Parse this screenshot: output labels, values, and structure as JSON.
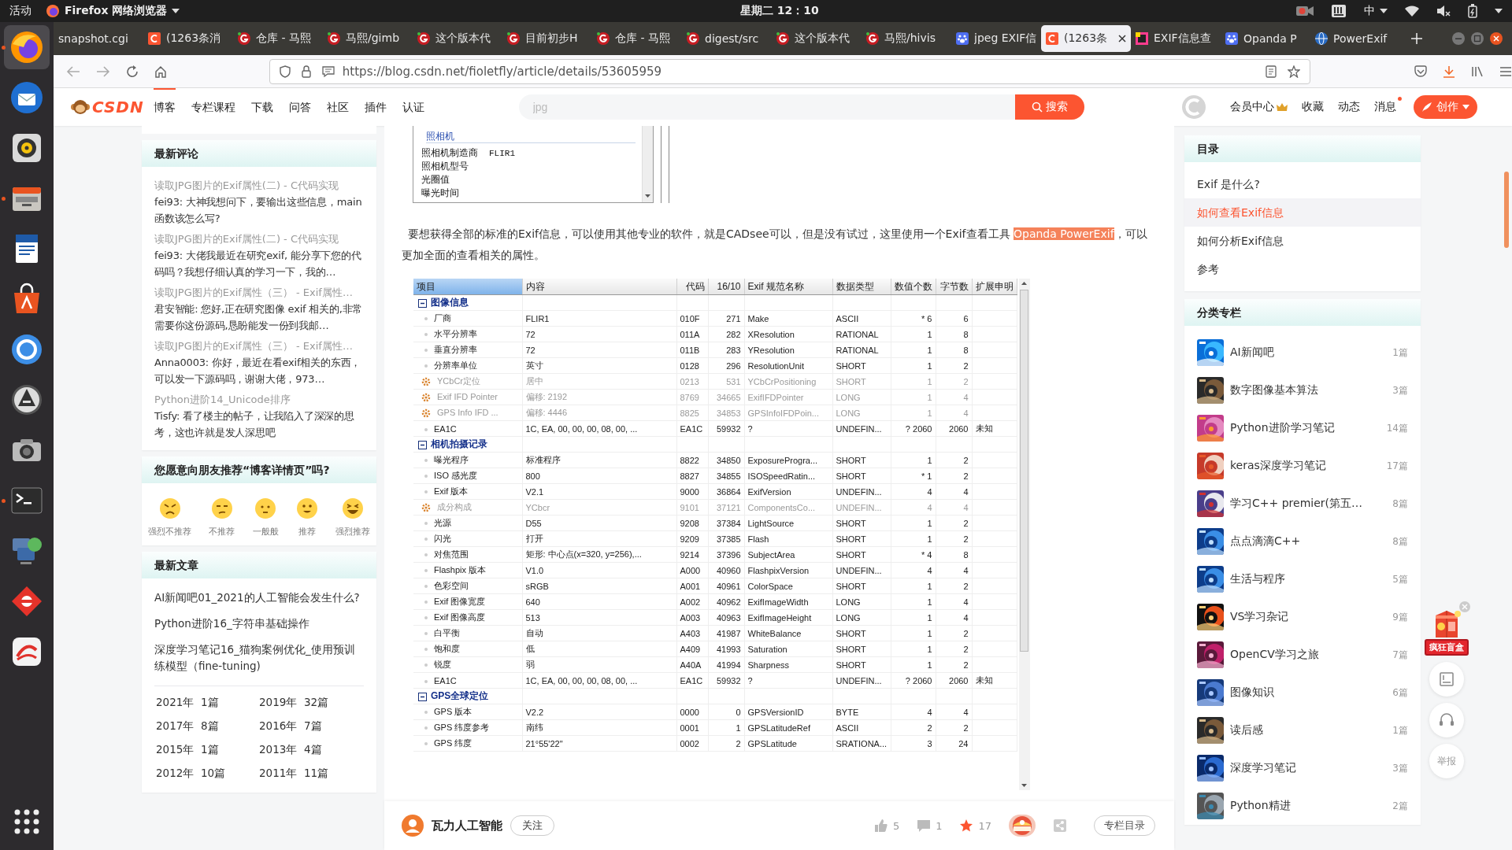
{
  "system_bar": {
    "activities": "活动",
    "app_menu": "Firefox 网络浏览器",
    "clock": "星期二 12：10",
    "input_method": "中"
  },
  "dock": [
    {
      "kind": "browser",
      "running": true,
      "selected": true
    },
    {
      "kind": "mail",
      "running": false,
      "selected": false
    },
    {
      "kind": "music",
      "running": false,
      "selected": false
    },
    {
      "kind": "files",
      "running": true,
      "selected": false
    },
    {
      "kind": "writer",
      "running": false,
      "selected": false
    },
    {
      "kind": "software",
      "running": false,
      "selected": false
    },
    {
      "kind": "help",
      "running": false,
      "selected": false
    },
    {
      "kind": "updater",
      "running": false,
      "selected": false
    },
    {
      "kind": "camera",
      "running": false,
      "selected": false
    },
    {
      "kind": "terminal",
      "running": true,
      "selected": false
    },
    {
      "kind": "network",
      "running": false,
      "selected": false
    },
    {
      "kind": "diamond",
      "running": false,
      "selected": false
    },
    {
      "kind": "swirl",
      "running": false,
      "selected": false
    },
    {
      "kind": "grid",
      "running": false,
      "selected": false
    }
  ],
  "tabs": [
    {
      "title": "snapshot.cgi",
      "kind": "plain",
      "selected": false
    },
    {
      "title": "(1263条消",
      "kind": "csdn",
      "selected": false
    },
    {
      "title": "仓库 - 马熙",
      "kind": "gitee",
      "selected": false
    },
    {
      "title": "马熙/gimb",
      "kind": "gitee",
      "selected": false
    },
    {
      "title": "这个版本代",
      "kind": "gitee",
      "selected": false
    },
    {
      "title": "目前初步H",
      "kind": "gitee",
      "selected": false
    },
    {
      "title": "仓库 - 马熙",
      "kind": "gitee",
      "selected": false
    },
    {
      "title": "digest/src",
      "kind": "gitee",
      "selected": false
    },
    {
      "title": "这个版本代",
      "kind": "gitee",
      "selected": false
    },
    {
      "title": "马熙/hivis",
      "kind": "gitee",
      "selected": false
    },
    {
      "title": "jpeg EXIF信",
      "kind": "paw",
      "selected": false
    },
    {
      "title": "(1263条",
      "kind": "csdn",
      "selected": true
    },
    {
      "title": "EXIF信息查",
      "kind": "exif",
      "selected": false
    },
    {
      "title": "Opanda P",
      "kind": "paw",
      "selected": false
    },
    {
      "title": "PowerExif",
      "kind": "globe",
      "selected": false
    }
  ],
  "address_bar": {
    "url": "https://blog.csdn.net/fioletfly/article/details/53605959"
  },
  "site_header": {
    "logo": "CSDN",
    "nav": [
      {
        "label": "博客",
        "selected": true
      },
      {
        "label": "专栏课程",
        "selected": false
      },
      {
        "label": "下载",
        "selected": false
      },
      {
        "label": "问答",
        "selected": false
      },
      {
        "label": "社区",
        "selected": false
      },
      {
        "label": "插件",
        "selected": false
      },
      {
        "label": "认证",
        "selected": false
      }
    ],
    "search": {
      "placeholder": "jpg",
      "button": "搜索"
    },
    "links": [
      {
        "label": "会员中心",
        "crown": true,
        "unread": false
      },
      {
        "label": "收藏",
        "crown": false,
        "unread": false
      },
      {
        "label": "动态",
        "crown": false,
        "unread": false
      },
      {
        "label": "消息",
        "crown": false,
        "unread": true
      }
    ],
    "create_button": "创作"
  },
  "left_sidebar": {
    "comments": {
      "title": "最新评论",
      "items": [
        {
          "article": "读取JPG图片的Exif属性(二) - C代码实现",
          "comment": "fei93: 大神我想问下，要输出这些信息，main函数该怎么写?"
        },
        {
          "article": "读取JPG图片的Exif属性(二) - C代码实现",
          "comment": "fei93: 大佬我最近在研究exif, 能分享下您的代码吗？我想仔细认真的学习一下，我的…"
        },
        {
          "article": "读取JPG图片的Exif属性（三） - Exif属性…",
          "comment": "君安智能: 您好,正在研究图像 exif 相关的,非常需要你这份源码,恳盼能发一份到我邮…"
        },
        {
          "article": "读取JPG图片的Exif属性（三） - Exif属性…",
          "comment": "Anna0003: 你好，最近在看exif相关的东西，可以发一下源码吗，谢谢大佬，973…"
        },
        {
          "article": "Python进阶14_Unicode排序",
          "comment": "Tisfy: 看了楼主的帖子，让我陷入了深深的思考，这也许就是发人深思吧"
        }
      ]
    },
    "recommend": {
      "title": "您愿意向朋友推荐“博客详情页”吗?",
      "options": [
        {
          "label": "强烈不推荐",
          "kind": "angry"
        },
        {
          "label": "不推荐",
          "kind": "sad"
        },
        {
          "label": "一般般",
          "kind": "neutral"
        },
        {
          "label": "推荐",
          "kind": "smile"
        },
        {
          "label": "强烈推荐",
          "kind": "laugh"
        }
      ]
    },
    "articles": {
      "title": "最新文章",
      "items": [
        "AI新闻吧01_2021的人工智能会发生什么?",
        "Python进阶16_字符串基础操作",
        "深度学习笔记16_猫狗案例优化_使用预训练模型（fine-tuning)"
      ],
      "archive": [
        "2021年  1篇",
        "2019年  32篇",
        "2017年  8篇",
        "2016年  7篇",
        "2015年  1篇",
        "2013年  4篇",
        "2012年  10篇",
        "2011年  11篇"
      ]
    }
  },
  "article": {
    "camera_list": {
      "group": "照相机",
      "items": [
        {
          "label": "照相机制造商",
          "value": "FLIR1"
        },
        {
          "label": "照相机型号"
        },
        {
          "label": "光圈值"
        },
        {
          "label": "曝光时间"
        }
      ]
    },
    "paragraph": {
      "before": "要想获得全部的标准的Exif信息，可以使用其他专业的软件，就是CADsee可以，但是没有试过，这里使用一个Exif查看工具 ",
      "link": "Opanda PowerExif",
      "after": "，可以更加全面的查看相关的属性。"
    },
    "exif_table": {
      "columns": [
        {
          "label": "项目",
          "sorted": true
        },
        {
          "label": "内容",
          "sorted": false
        },
        {
          "label": "代码",
          "sorted": false
        },
        {
          "label": "16/10",
          "sorted": false
        },
        {
          "label": "Exif 规范名称",
          "sorted": false
        },
        {
          "label": "数据类型",
          "sorted": false
        },
        {
          "label": "数值个数",
          "sorted": false
        },
        {
          "label": "字节数",
          "sorted": false
        },
        {
          "label": "扩展申明",
          "sorted": false
        }
      ],
      "rows": [
        {
          "kind": "group",
          "label": "图像信息",
          "expanded": true
        },
        {
          "kind": "tag",
          "muted": false,
          "cells": [
            "厂商",
            "FLIR1",
            "010F",
            "271",
            "Make",
            "ASCII",
            "* 6",
            "6"
          ]
        },
        {
          "kind": "tag",
          "muted": false,
          "cells": [
            "水平分辨率",
            "72",
            "011A",
            "282",
            "XResolution",
            "RATIONAL",
            "1",
            "8"
          ]
        },
        {
          "kind": "tag",
          "muted": false,
          "cells": [
            "垂直分辨率",
            "72",
            "011B",
            "283",
            "YResolution",
            "RATIONAL",
            "1",
            "8"
          ]
        },
        {
          "kind": "tag",
          "muted": false,
          "cells": [
            "分辨率单位",
            "英寸",
            "0128",
            "296",
            "ResolutionUnit",
            "SHORT",
            "1",
            "2"
          ]
        },
        {
          "kind": "tag",
          "muted": true,
          "cells": [
            "YCbCr定位",
            "居中",
            "0213",
            "531",
            "YCbCrPositioning",
            "SHORT",
            "1",
            "2"
          ]
        },
        {
          "kind": "tag",
          "muted": true,
          "cells": [
            "Exif IFD Pointer",
            "偏移: 2192",
            "8769",
            "34665",
            "ExifIFDPointer",
            "LONG",
            "1",
            "4"
          ]
        },
        {
          "kind": "tag",
          "muted": true,
          "cells": [
            "GPS Info IFD ...",
            "偏移: 4446",
            "8825",
            "34853",
            "GPSInfoIFDPoin...",
            "LONG",
            "1",
            "4"
          ]
        },
        {
          "kind": "tag",
          "muted": false,
          "cells": [
            "EA1C",
            "1C, EA, 00, 00, 00, 08, 00, ...",
            "EA1C",
            "59932",
            "?",
            "UNDEFIN...",
            "? 2060",
            "2060"
          ],
          "extension": "未知"
        },
        {
          "kind": "group",
          "label": "相机拍摄记录",
          "expanded": true
        },
        {
          "kind": "tag",
          "muted": false,
          "cells": [
            "曝光程序",
            "标准程序",
            "8822",
            "34850",
            "ExposureProgra...",
            "SHORT",
            "1",
            "2"
          ]
        },
        {
          "kind": "tag",
          "muted": false,
          "cells": [
            "ISO 感光度",
            "800",
            "8827",
            "34855",
            "ISOSpeedRatin...",
            "SHORT",
            "* 1",
            "2"
          ]
        },
        {
          "kind": "tag",
          "muted": false,
          "cells": [
            "Exif 版本",
            "V2.1",
            "9000",
            "36864",
            "ExifVersion",
            "UNDEFIN...",
            "4",
            "4"
          ]
        },
        {
          "kind": "tag",
          "muted": true,
          "cells": [
            "成分构成",
            "YCbcr",
            "9101",
            "37121",
            "ComponentsCo...",
            "UNDEFIN...",
            "4",
            "4"
          ]
        },
        {
          "kind": "tag",
          "muted": false,
          "cells": [
            "光源",
            "D55",
            "9208",
            "37384",
            "LightSource",
            "SHORT",
            "1",
            "2"
          ]
        },
        {
          "kind": "tag",
          "muted": false,
          "cells": [
            "闪光",
            "打开",
            "9209",
            "37385",
            "Flash",
            "SHORT",
            "1",
            "2"
          ]
        },
        {
          "kind": "tag",
          "muted": false,
          "cells": [
            "对焦范围",
            "矩形: 中心点(x=320, y=256),...",
            "9214",
            "37396",
            "SubjectArea",
            "SHORT",
            "* 4",
            "8"
          ]
        },
        {
          "kind": "tag",
          "muted": false,
          "cells": [
            "Flashpix 版本",
            "V1.0",
            "A000",
            "40960",
            "FlashpixVersion",
            "UNDEFIN...",
            "4",
            "4"
          ]
        },
        {
          "kind": "tag",
          "muted": false,
          "cells": [
            "色彩空间",
            "sRGB",
            "A001",
            "40961",
            "ColorSpace",
            "SHORT",
            "1",
            "2"
          ]
        },
        {
          "kind": "tag",
          "muted": false,
          "cells": [
            "Exif 图像宽度",
            "640",
            "A002",
            "40962",
            "ExifImageWidth",
            "LONG",
            "1",
            "4"
          ]
        },
        {
          "kind": "tag",
          "muted": false,
          "cells": [
            "Exif 图像高度",
            "513",
            "A003",
            "40963",
            "ExifImageHeight",
            "LONG",
            "1",
            "4"
          ]
        },
        {
          "kind": "tag",
          "muted": false,
          "cells": [
            "白平衡",
            "自动",
            "A403",
            "41987",
            "WhiteBalance",
            "SHORT",
            "1",
            "2"
          ]
        },
        {
          "kind": "tag",
          "muted": false,
          "cells": [
            "饱和度",
            "低",
            "A409",
            "41993",
            "Saturation",
            "SHORT",
            "1",
            "2"
          ]
        },
        {
          "kind": "tag",
          "muted": false,
          "cells": [
            "锐度",
            "弱",
            "A40A",
            "41994",
            "Sharpness",
            "SHORT",
            "1",
            "2"
          ]
        },
        {
          "kind": "tag",
          "muted": false,
          "cells": [
            "EA1C",
            "1C, EA, 00, 00, 00, 08, 00, ...",
            "EA1C",
            "59932",
            "?",
            "UNDEFIN...",
            "? 2060",
            "2060"
          ],
          "extension": "未知"
        },
        {
          "kind": "group",
          "label": "GPS全球定位",
          "expanded": true
        },
        {
          "kind": "tag",
          "muted": false,
          "cells": [
            "GPS 版本",
            "V2.2",
            "0000",
            "0",
            "GPSVersionID",
            "BYTE",
            "4",
            "4"
          ]
        },
        {
          "kind": "tag",
          "muted": false,
          "cells": [
            "GPS 纬度参考",
            "南纬",
            "0001",
            "1",
            "GPSLatitudeRef",
            "ASCII",
            "2",
            "2"
          ]
        },
        {
          "kind": "tag",
          "muted": false,
          "cells": [
            "GPS 纬度",
            "21°55'22\"",
            "0002",
            "2",
            "GPSLatitude",
            "SRATIONA...",
            "3",
            "24"
          ]
        }
      ]
    }
  },
  "article_toolbar": {
    "author": "瓦力人工智能",
    "follow": "关注",
    "likes": "5",
    "comments": "1",
    "favorites": "17",
    "column_list": "专栏目录"
  },
  "right_sidebar": {
    "toc": {
      "title": "目录",
      "items": [
        {
          "label": "Exif 是什么?",
          "selected": false
        },
        {
          "label": "如何查看Exif信息",
          "selected": true
        },
        {
          "label": "如何分析Exif信息",
          "selected": false
        },
        {
          "label": "参考",
          "selected": false
        }
      ]
    },
    "columns": {
      "title": "分类专栏",
      "items": [
        {
          "name": "AI新闻吧",
          "count": "1篇"
        },
        {
          "name": "数字图像基本算法",
          "count": "3篇"
        },
        {
          "name": "Python进阶学习笔记",
          "count": "14篇"
        },
        {
          "name": "keras深度学习笔记",
          "count": "17篇"
        },
        {
          "name": "学习C++ premier(第五…",
          "count": "8篇"
        },
        {
          "name": "点点滴滴C++",
          "count": "8篇"
        },
        {
          "name": "生活与程序",
          "count": "5篇"
        },
        {
          "name": "VS学习杂记",
          "count": "9篇"
        },
        {
          "name": "OpenCV学习之旅",
          "count": "7篇"
        },
        {
          "name": "图像知识",
          "count": "6篇"
        },
        {
          "name": "读后感",
          "count": "1篇"
        },
        {
          "name": "深度学习笔记",
          "count": "3篇"
        },
        {
          "name": "Python精进",
          "count": "2篇"
        }
      ]
    }
  },
  "float_tools": {
    "ad_label": "疯狂盲盒",
    "report": "举报"
  }
}
